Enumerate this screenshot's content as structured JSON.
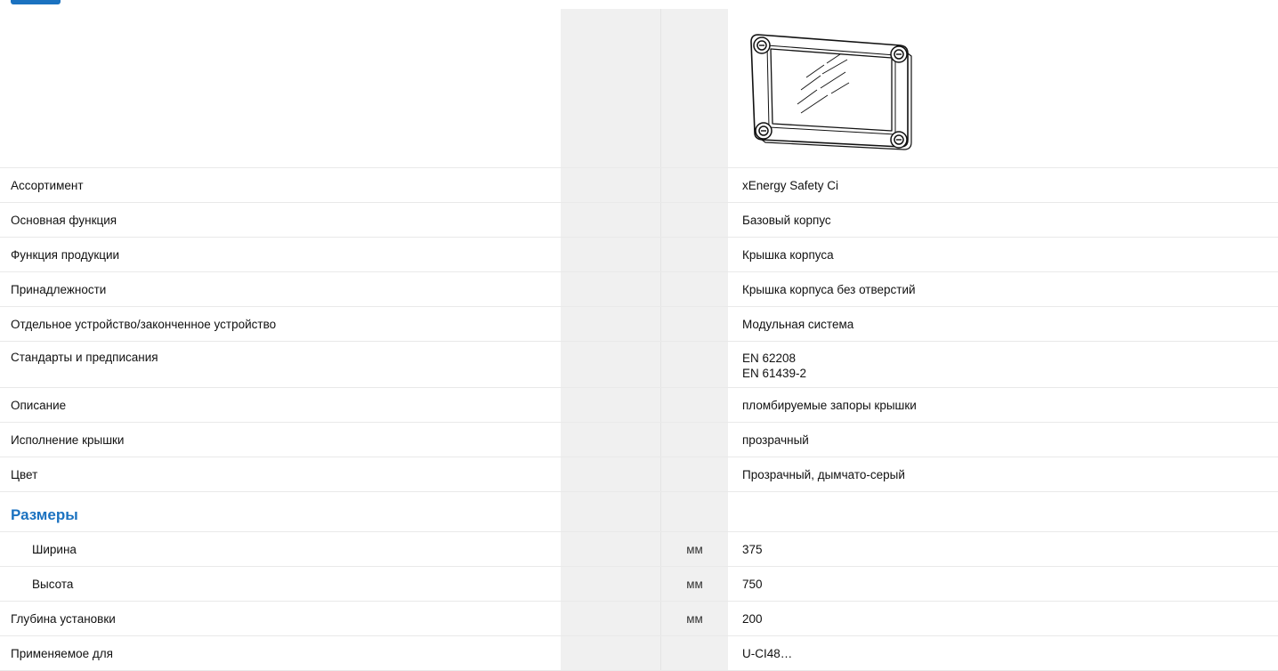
{
  "rows": [
    {
      "label": "Ассортимент",
      "unit": "",
      "value": "xEnergy Safety Ci"
    },
    {
      "label": "Основная функция",
      "unit": "",
      "value": "Базовый корпус"
    },
    {
      "label": "Функция продукции",
      "unit": "",
      "value": "Крышка корпуса"
    },
    {
      "label": "Принадлежности",
      "unit": "",
      "value": "Крышка корпуса без отверстий"
    },
    {
      "label": "Отдельное устройство/законченное устройство",
      "unit": "",
      "value": "Модульная система"
    },
    {
      "label": "Стандарты и предписания",
      "unit": "",
      "values": [
        "EN 62208",
        "EN 61439-2"
      ]
    },
    {
      "label": "Описание",
      "unit": "",
      "value": "пломбируемые запоры крышки"
    },
    {
      "label": "Исполнение крышки",
      "unit": "",
      "value": "прозрачный"
    },
    {
      "label": "Цвет",
      "unit": "",
      "value": "Прозрачный, дымчато-серый"
    }
  ],
  "section": {
    "title": "Размеры"
  },
  "dimension_rows": [
    {
      "label": "Ширина",
      "unit": "мм",
      "value": "375"
    },
    {
      "label": "Высота",
      "unit": "мм",
      "value": "750"
    }
  ],
  "tail_rows": [
    {
      "label": "Глубина установки",
      "unit": "мм",
      "value": "200"
    },
    {
      "label": "Применяемое для",
      "unit": "",
      "value": "U-CI48…"
    }
  ],
  "image": {
    "icon": "enclosure-cover-icon"
  }
}
